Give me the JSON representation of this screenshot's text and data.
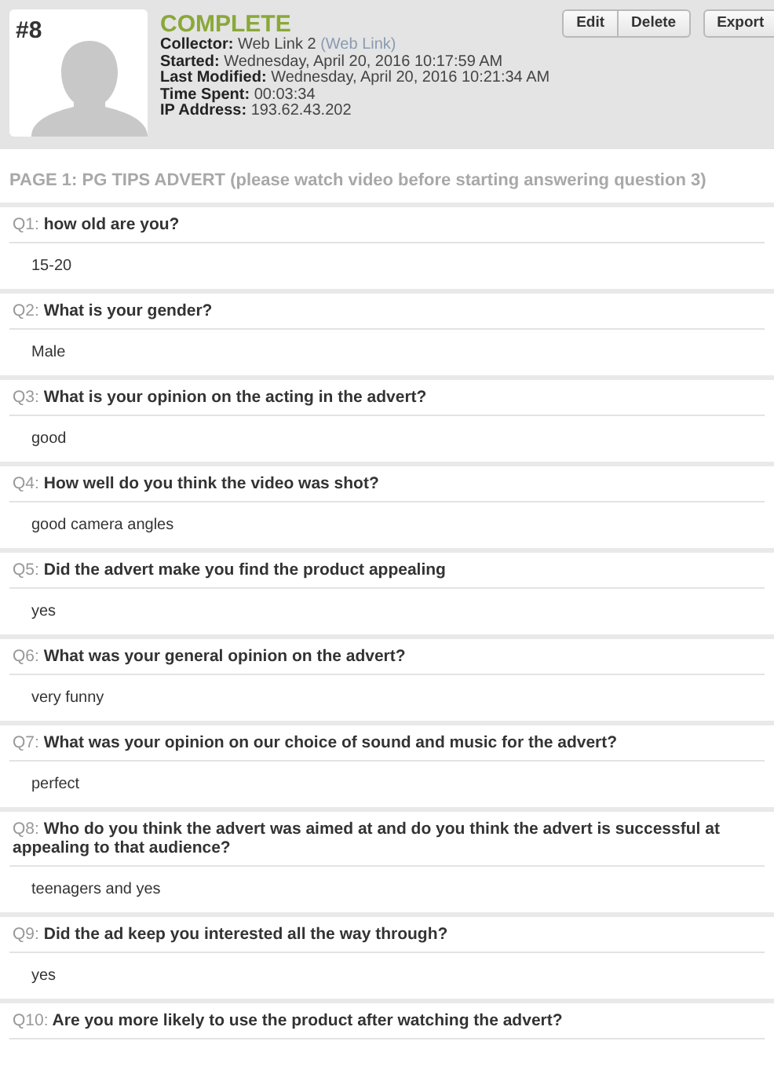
{
  "response": {
    "number": "#8",
    "status": "COMPLETE",
    "details": [
      {
        "label": "Collector:",
        "value": "Web Link 2",
        "note": "(Web Link)"
      },
      {
        "label": "Started:",
        "value": "Wednesday, April 20, 2016 10:17:59 AM"
      },
      {
        "label": "Last Modified:",
        "value": "Wednesday, April 20, 2016 10:21:34 AM"
      },
      {
        "label": "Time Spent:",
        "value": "00:03:34"
      },
      {
        "label": "IP Address:",
        "value": "193.62.43.202"
      }
    ],
    "button_groups": [
      [
        "Edit",
        "Delete"
      ],
      [
        "Export"
      ]
    ]
  },
  "page_title": "PAGE 1: PG TIPS ADVERT (please watch video before starting answering question 3)",
  "questions": [
    {
      "number": "Q1:",
      "text": "how old are you?",
      "answer": "15-20"
    },
    {
      "number": "Q2:",
      "text": "What is your gender?",
      "answer": "Male"
    },
    {
      "number": "Q3:",
      "text": "What is your opinion on the acting in the advert?",
      "answer": "good"
    },
    {
      "number": "Q4:",
      "text": "How well do you think the video was shot?",
      "answer": "good camera angles"
    },
    {
      "number": "Q5:",
      "text": "Did the advert make you find the product appealing",
      "answer": "yes"
    },
    {
      "number": "Q6:",
      "text": "What was your general opinion on the advert?",
      "answer": "very funny"
    },
    {
      "number": "Q7:",
      "text": "What was your opinion on our choice of sound and music for the advert?",
      "answer": "perfect"
    },
    {
      "number": "Q8:",
      "text": "Who do you think the advert was aimed at and do you think the advert is successful at appealing to that audience?",
      "answer": "teenagers and yes"
    },
    {
      "number": "Q9:",
      "text": "Did the ad keep you interested all the way through?",
      "answer": "yes"
    },
    {
      "number": "Q10:",
      "text": "Are you more likely to use the product after watching the advert?"
    }
  ]
}
